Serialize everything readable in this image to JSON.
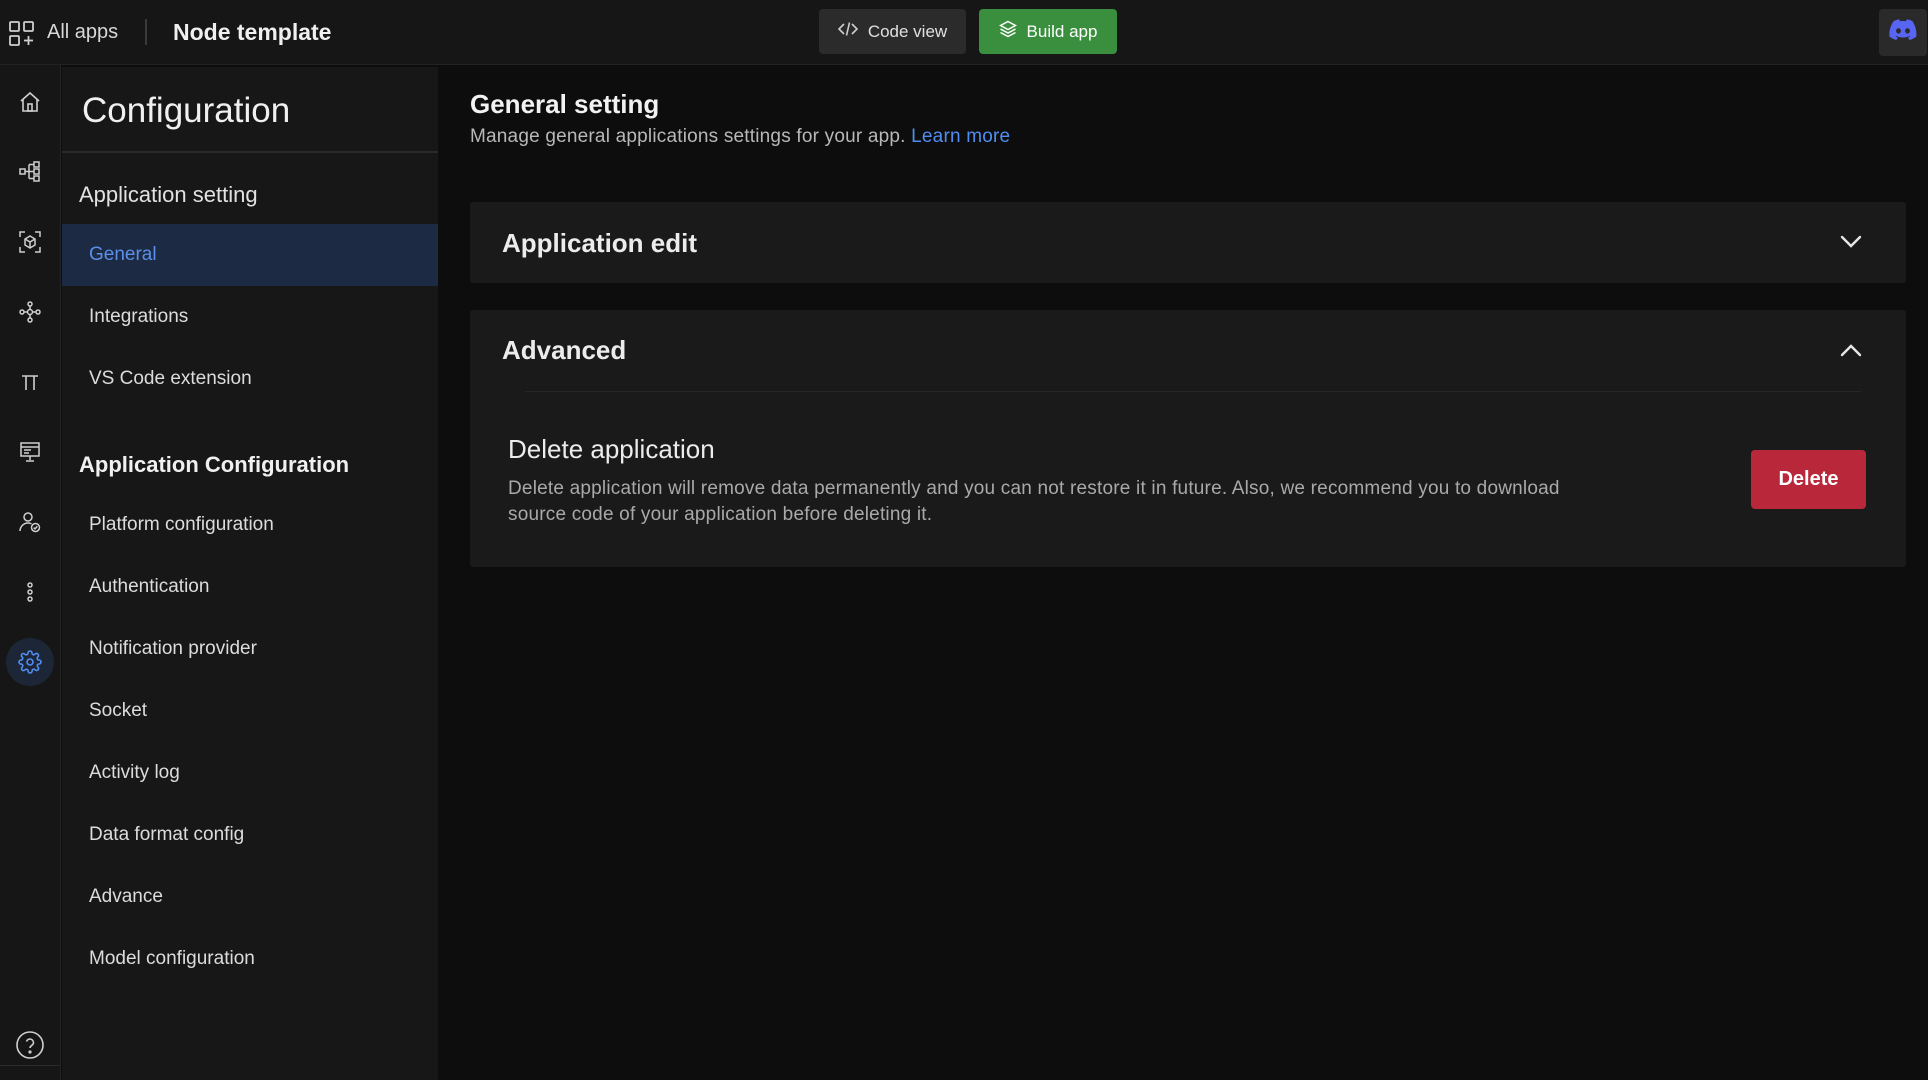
{
  "topbar": {
    "all_apps_label": "All apps",
    "project_title": "Node template",
    "code_view_label": "Code view",
    "build_app_label": "Build app"
  },
  "rail": {
    "icons": [
      "home-icon",
      "flow-icon",
      "model-icon",
      "graph-icon",
      "pi-icon",
      "presentation-icon",
      "user-check-icon",
      "more-icon",
      "settings-icon"
    ],
    "active": "settings-icon",
    "help_icon": "help-icon"
  },
  "config": {
    "title": "Configuration",
    "app_setting_heading": "Application setting",
    "app_setting_items": [
      "General",
      "Integrations",
      "VS Code extension"
    ],
    "active_item": "General",
    "app_config_heading": "Application Configuration",
    "app_config_items": [
      "Platform configuration",
      "Authentication",
      "Notification provider",
      "Socket",
      "Activity log",
      "Data format config",
      "Advance",
      "Model configuration"
    ]
  },
  "main": {
    "title": "General setting",
    "subtitle": "Manage general applications settings for your app.",
    "learn_more": "Learn more",
    "app_edit_title": "Application edit",
    "advanced_title": "Advanced",
    "delete_title": "Delete application",
    "delete_desc": "Delete application will remove data permanently and you can not restore it in future. Also, we recommend you to download source code of your application before deleting it.",
    "delete_button": "Delete"
  },
  "colors": {
    "accent_blue": "#4f8ef0",
    "build_green": "#3a8f3e",
    "delete_red": "#b8283a",
    "discord": "#5865f2"
  }
}
